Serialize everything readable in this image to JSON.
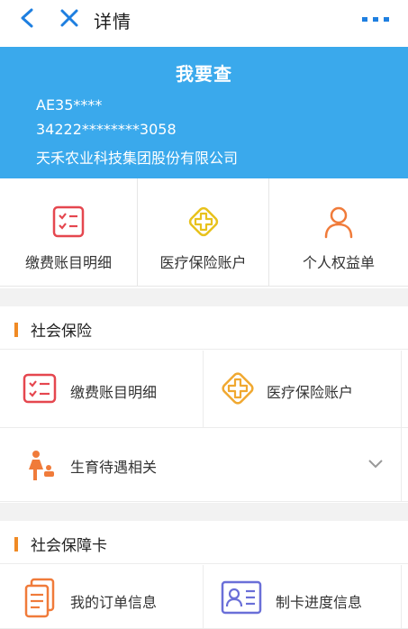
{
  "topbar": {
    "title": "详情"
  },
  "banner": {
    "title": "我要查",
    "code": "AE35****",
    "id_number": "34222********3058",
    "company": "天禾农业科技集团股份有限公司"
  },
  "quick_actions": [
    {
      "label": "缴费账目明细",
      "icon": "checklist-icon"
    },
    {
      "label": "医疗保险账户",
      "icon": "medical-cross-icon"
    },
    {
      "label": "个人权益单",
      "icon": "person-icon"
    }
  ],
  "social_insurance": {
    "title": "社会保险",
    "items": [
      {
        "label": "缴费账目明细",
        "icon": "checklist-icon"
      },
      {
        "label": "医疗保险账户",
        "icon": "medical-cross-icon"
      }
    ],
    "maternity": {
      "label": "生育待遇相关",
      "icon": "mother-child-icon"
    }
  },
  "social_card": {
    "title": "社会保障卡",
    "items": [
      {
        "label": "我的订单信息",
        "icon": "document-icon"
      },
      {
        "label": "制卡进度信息",
        "icon": "id-card-icon"
      }
    ]
  },
  "colors": {
    "banner": "#3aa9ec",
    "accent_blue": "#1e7fe0",
    "section_bar": "#f08a24",
    "checklist_red": "#e5474f",
    "cross_yellow": "#e8c21c",
    "person_orange": "#f07b3a",
    "idcard_purple": "#6a6fd8"
  }
}
